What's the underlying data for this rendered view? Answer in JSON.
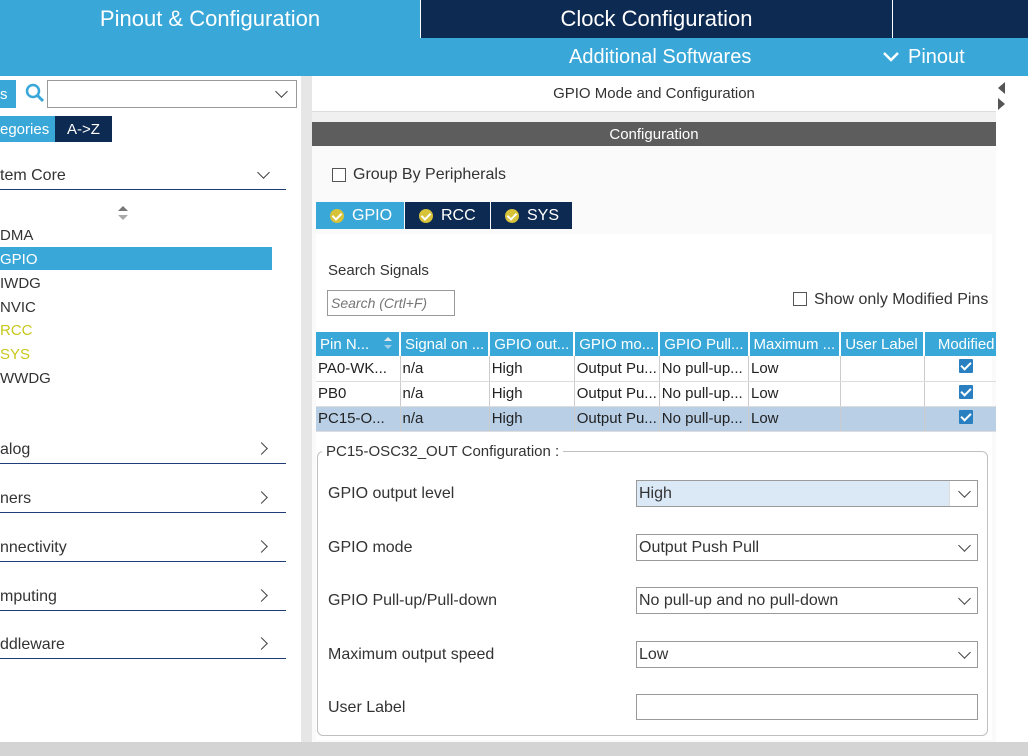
{
  "top_tabs": {
    "pinout_config": "Pinout & Configuration",
    "clock_config": "Clock Configuration"
  },
  "subbar": {
    "additional_softwares": "Additional Softwares",
    "pinout_menu": "Pinout"
  },
  "left": {
    "categories_tab_partial": "s",
    "search_value": "",
    "tab_categories_partial": "egories",
    "tab_az": "A->Z",
    "system_core_partial": "tem Core",
    "items": [
      {
        "label": "DMA",
        "color": "#333333"
      },
      {
        "label": "GPIO",
        "color": "#ffffff"
      },
      {
        "label": "IWDG",
        "color": "#333333"
      },
      {
        "label": "NVIC",
        "color": "#333333"
      },
      {
        "label": "RCC",
        "color": "#c8c81e"
      },
      {
        "label": "SYS",
        "color": "#c8c81e"
      },
      {
        "label": "WWDG",
        "color": "#333333"
      }
    ],
    "sections": [
      "alog",
      "ners",
      "nnectivity",
      "mputing",
      "ddleware"
    ]
  },
  "right": {
    "mode_header": "GPIO Mode and Configuration",
    "config_bar": "Configuration",
    "group_by_peripherals": "Group By Peripherals",
    "periph_tabs": [
      "GPIO",
      "RCC",
      "SYS"
    ],
    "search_signals_label": "Search Signals",
    "search_placeholder": "Search (Crtl+F)",
    "show_only_modified": "Show only Modified Pins",
    "table": {
      "headers": [
        "Pin N...",
        "Signal on ...",
        "GPIO out...",
        "GPIO mo...",
        "GPIO Pull...",
        "Maximum ...",
        "User Label",
        "Modified"
      ],
      "rows": [
        [
          "PA0-WK...",
          "n/a",
          "High",
          "Output Pu...",
          "No pull-up...",
          "Low",
          ""
        ],
        [
          "PB0",
          "n/a",
          "High",
          "Output Pu...",
          "No pull-up...",
          "Low",
          ""
        ],
        [
          "PC15-O...",
          "n/a",
          "High",
          "Output Pu...",
          "No pull-up...",
          "Low",
          ""
        ]
      ]
    },
    "pin_config_title": "PC15-OSC32_OUT Configuration :",
    "fields": {
      "output_level_label": "GPIO output level",
      "output_level_value": "High",
      "mode_label": "GPIO mode",
      "mode_value": "Output Push Pull",
      "pull_label": "GPIO Pull-up/Pull-down",
      "pull_value": "No pull-up and no pull-down",
      "speed_label": "Maximum output speed",
      "speed_value": "Low",
      "user_label_label": "User Label",
      "user_label_value": ""
    }
  },
  "colors": {
    "accent_blue": "#39a8d8",
    "dark_navy": "#0d2a52",
    "selected_row": "#b8cfe6"
  }
}
